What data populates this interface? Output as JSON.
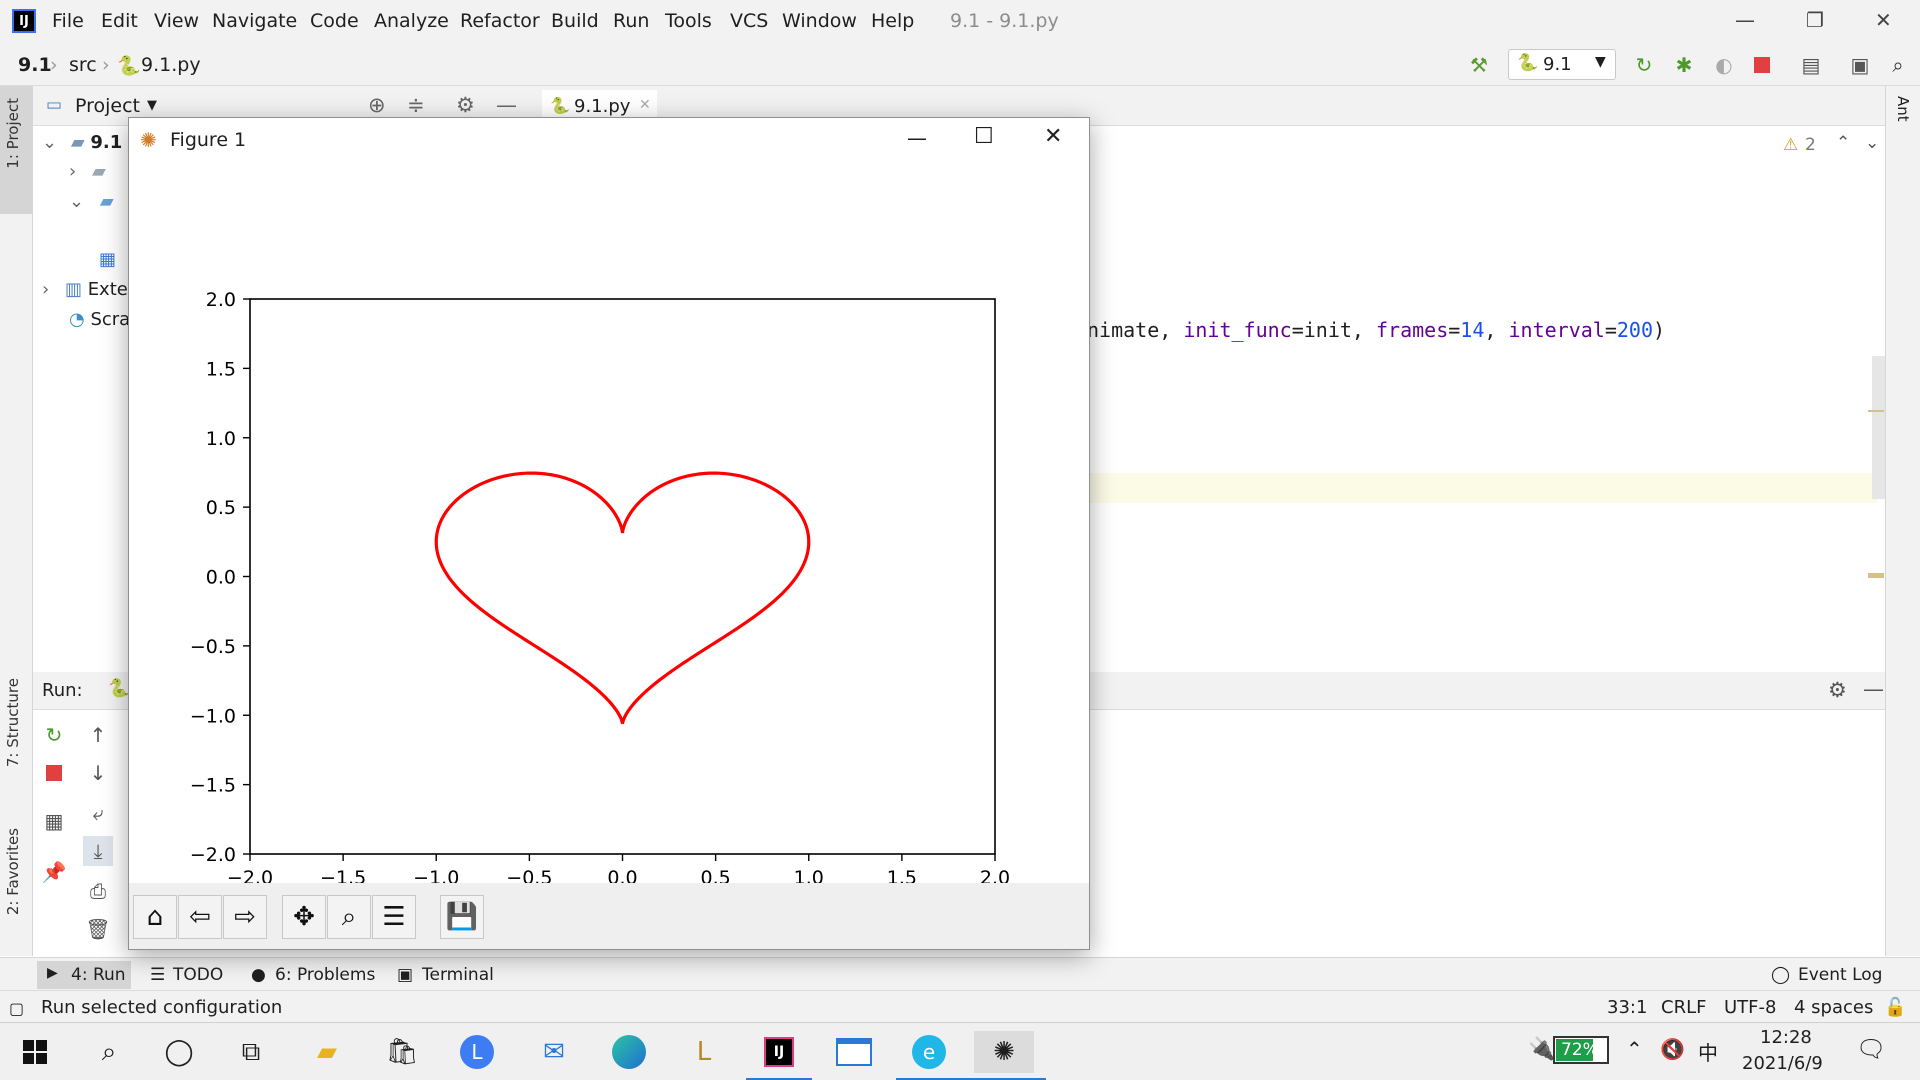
{
  "menubar": {
    "items": [
      "File",
      "Edit",
      "View",
      "Navigate",
      "Code",
      "Analyze",
      "Refactor",
      "Build",
      "Run",
      "Tools",
      "VCS",
      "Window",
      "Help"
    ],
    "window_title": "9.1 - 9.1.py"
  },
  "navbar": {
    "project": "9.1",
    "folder": "src",
    "file": "9.1.py",
    "run_config": "9.1"
  },
  "project_panel": {
    "title": "Project",
    "root": "9.1",
    "ext_libs": "Exte",
    "scratches": "Scra"
  },
  "editor": {
    "tab": "9.1.py",
    "warnings": "2",
    "code": {
      "pre": "nimate, ",
      "p1": "init_func",
      "v1": "=init, ",
      "p2": "frames",
      "v2a": "=",
      "n2": "14",
      "v2b": ", ",
      "p3": "interval",
      "v3a": "=",
      "n3": "200",
      "post": ")"
    }
  },
  "left_strip": {
    "project": "1: Project",
    "structure": "7: Structure",
    "favorites": "2: Favorites"
  },
  "right_strip": {
    "ant": "Ant"
  },
  "run_panel": {
    "label": "Run:"
  },
  "bottom_tabs": {
    "run": "4: Run",
    "todo": "TODO",
    "problems": "6: Problems",
    "terminal": "Terminal",
    "event_log": "Event Log"
  },
  "status": {
    "message": "Run selected configuration",
    "position": "33:1",
    "line_sep": "CRLF",
    "encoding": "UTF-8",
    "indent": "4 spaces"
  },
  "taskbar": {
    "battery": "72%",
    "ime": "中",
    "time": "12:28",
    "date": "2021/6/9"
  },
  "figure": {
    "title": "Figure 1"
  },
  "chart_data": {
    "type": "line",
    "series": [
      {
        "color": "#ff0000",
        "curve": "heart: x = sin^3(t), y = (13cos t - 5cos 2t - 2cos 3t - cos 4t)/16",
        "t_range": [
          0,
          6.2832
        ]
      }
    ],
    "xlim": [
      -2.0,
      2.0
    ],
    "ylim": [
      -2.0,
      2.0
    ],
    "xticks": [
      "−2.0",
      "−1.5",
      "−1.0",
      "−0.5",
      "0.0",
      "0.5",
      "1.0",
      "1.5",
      "2.0"
    ],
    "yticks": [
      "2.0",
      "1.5",
      "1.0",
      "0.5",
      "0.0",
      "−0.5",
      "−1.0",
      "−1.5",
      "−2.0"
    ],
    "xtick_values": [
      -2.0,
      -1.5,
      -1.0,
      -0.5,
      0.0,
      0.5,
      1.0,
      1.5,
      2.0
    ],
    "ytick_values": [
      2.0,
      1.5,
      1.0,
      0.5,
      0.0,
      -0.5,
      -1.0,
      -1.5,
      -2.0
    ],
    "grid": false,
    "title": "",
    "xlabel": "",
    "ylabel": ""
  }
}
